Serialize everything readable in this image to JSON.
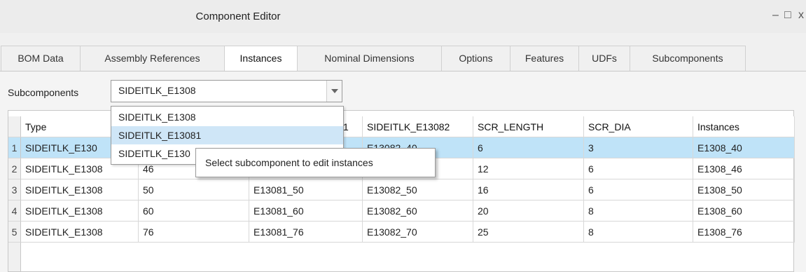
{
  "window": {
    "title": "Component Editor",
    "minimize": "–",
    "maximize": "□",
    "close": "x"
  },
  "tabs": [
    {
      "label": "BOM Data",
      "active": false
    },
    {
      "label": "Assembly References",
      "active": false
    },
    {
      "label": "Instances",
      "active": true
    },
    {
      "label": "Nominal Dimensions",
      "active": false
    },
    {
      "label": "Options",
      "active": false
    },
    {
      "label": "Features",
      "active": false
    },
    {
      "label": "UDFs",
      "active": false
    },
    {
      "label": "Subcomponents",
      "active": false
    }
  ],
  "subcomponents": {
    "label": "Subcomponents",
    "selected": "SIDEITLK_E1308",
    "options": [
      "SIDEITLK_E1308",
      "SIDEITLK_E13081",
      "SIDEITLK_E130"
    ],
    "highlighted_index": 1
  },
  "tooltip": "Select subcomponent to edit instances",
  "table": {
    "columns": [
      "Type",
      "",
      "1",
      "SIDEITLK_E13082",
      "SCR_LENGTH",
      "SCR_DIA",
      "Instances"
    ],
    "rows": [
      {
        "num": "1",
        "cells": [
          "SIDEITLK_E130",
          "",
          "",
          "E13082_40",
          "6",
          "3",
          "E1308_40"
        ],
        "selected": true
      },
      {
        "num": "2",
        "cells": [
          "SIDEITLK_E1308",
          "46",
          "",
          "",
          "12",
          "6",
          "E1308_46"
        ],
        "selected": false
      },
      {
        "num": "3",
        "cells": [
          "SIDEITLK_E1308",
          "50",
          "E13081_50",
          "E13082_50",
          "16",
          "6",
          "E1308_50"
        ],
        "selected": false
      },
      {
        "num": "4",
        "cells": [
          "SIDEITLK_E1308",
          "60",
          "E13081_60",
          "E13082_60",
          "20",
          "8",
          "E1308_60"
        ],
        "selected": false
      },
      {
        "num": "5",
        "cells": [
          "SIDEITLK_E1308",
          "76",
          "E13081_76",
          "E13082_70",
          "25",
          "8",
          "E1308_76"
        ],
        "selected": false
      }
    ]
  }
}
